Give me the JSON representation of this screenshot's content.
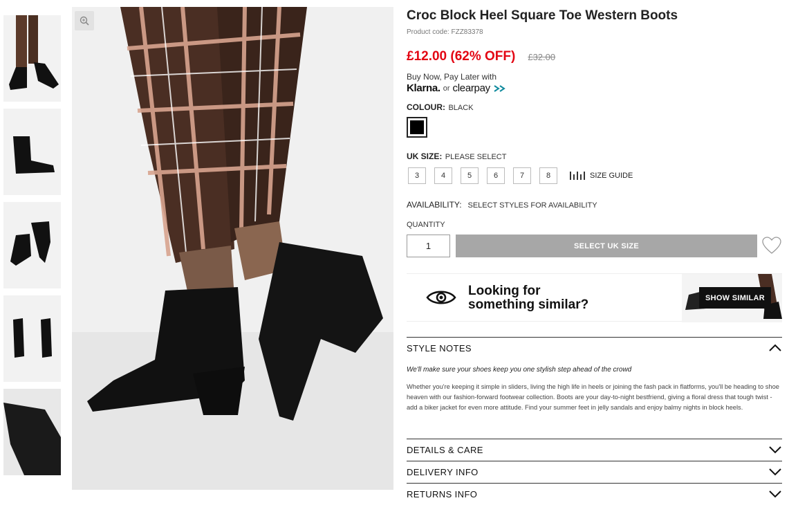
{
  "product": {
    "title": "Croc Block Heel Square Toe Western Boots",
    "code": "Product code: FZZ83378",
    "price": "£12.00 (62% OFF)",
    "was_price": "£32.00"
  },
  "payment": {
    "bnpl_text": "Buy Now, Pay Later with",
    "klarna": "Klarna.",
    "or": "or",
    "clearpay": "clearpay"
  },
  "colour": {
    "label": "COLOUR:",
    "value": "BLACK",
    "swatch_color": "#000000"
  },
  "size": {
    "label": "UK SIZE:",
    "value": "PLEASE SELECT",
    "options": [
      "3",
      "4",
      "5",
      "6",
      "7",
      "8"
    ],
    "guide": "SIZE GUIDE"
  },
  "availability": {
    "label": "AVAILABILITY:",
    "value": "SELECT STYLES FOR AVAILABILITY"
  },
  "quantity": {
    "label": "QUANTITY",
    "value": "1"
  },
  "add_button": "SELECT UK SIZE",
  "similar": {
    "line1": "Looking for",
    "line2": "something similar?",
    "button": "SHOW SIMILAR"
  },
  "accordion": {
    "style_notes": "STYLE NOTES",
    "tagline": "We'll make sure your shoes keep you one stylish step ahead of the crowd",
    "description": "Whether you're keeping it simple in sliders, living the high life in heels or joining the fash pack in flatforms, you'll be heading to shoe heaven with our fashion-forward footwear collection. Boots are your day-to-night bestfriend, giving a floral dress that tough twist - add a biker jacket for even more attitude. Find your summer feet in jelly sandals and enjoy balmy nights in block heels.",
    "details": "DETAILS & CARE",
    "delivery": "DELIVERY INFO",
    "returns": "RETURNS INFO"
  },
  "colors": {
    "sale_red": "#e30613",
    "button_grey": "#a7a7a7",
    "dark": "#111111"
  },
  "icons": [
    "zoom-icon",
    "size-guide-icon",
    "heart-icon",
    "eye-icon",
    "chevron-up-icon",
    "chevron-down-icon"
  ]
}
